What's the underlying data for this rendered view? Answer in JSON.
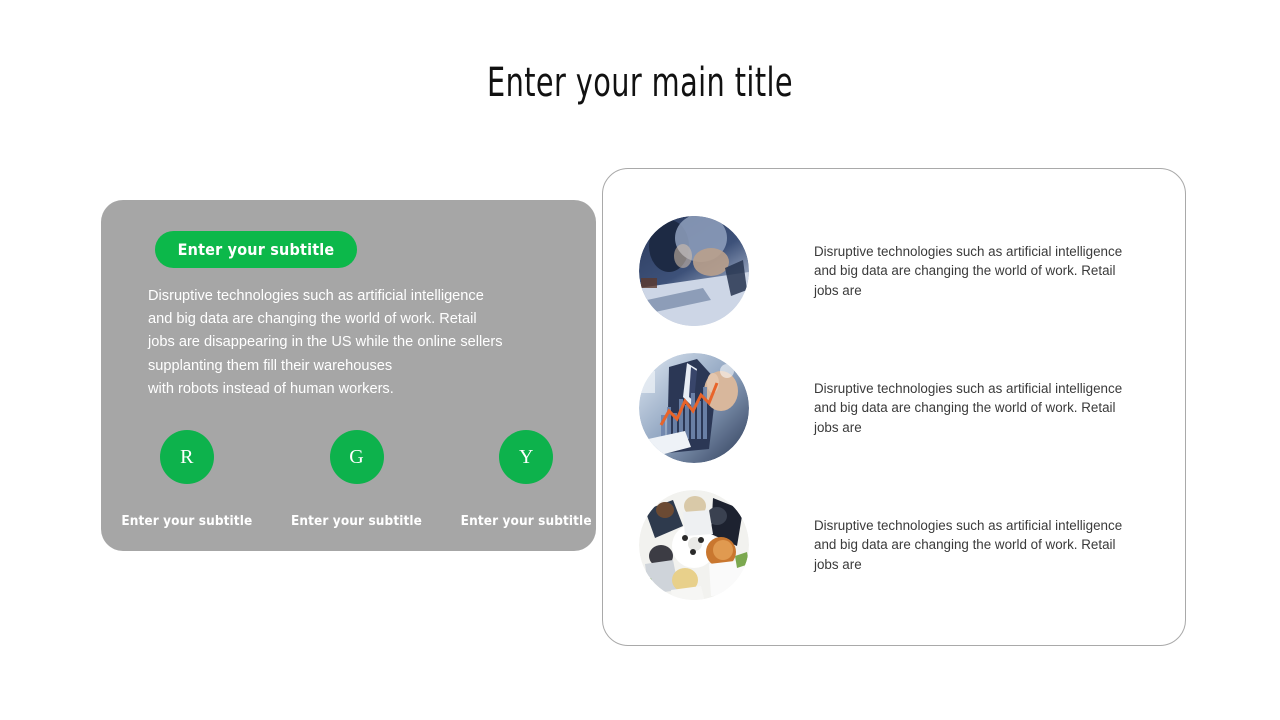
{
  "slide": {
    "title": "Enter your main title",
    "background_color": "#ffffff"
  },
  "theme": {
    "accent_green": "#0cb84a",
    "circle_green": "#0db24c",
    "panel_gray": "#a6a6a6",
    "card_border": "#a9a9a9",
    "body_text_dark": "#3a3a3a",
    "body_text_light": "#ffffff"
  },
  "left_panel": {
    "subtitle_button": "Enter your subtitle",
    "paragraph_lines": [
      "Disruptive technologies such as artificial intelligence",
      "and big data are changing the world of work.  Retail",
      "jobs are disappearing in the US while the online sellers",
      "supplanting them fill their warehouses",
      "with robots instead of human workers."
    ],
    "icons": [
      {
        "letter": "R",
        "caption": "Enter your subtitle"
      },
      {
        "letter": "G",
        "caption": "Enter your subtitle"
      },
      {
        "letter": "Y",
        "caption": "Enter your subtitle"
      }
    ]
  },
  "right_card": {
    "rows": [
      {
        "image_name": "photo-meeting-desk",
        "text_lines": [
          "Disruptive technologies such as artificial intelligence",
          "and big data are changing the world of work.  Retail",
          "jobs are"
        ]
      },
      {
        "image_name": "photo-businessman-chart",
        "text_lines": [
          "Disruptive technologies such as artificial intelligence",
          "and big data are changing the world of work.  Retail",
          "jobs are"
        ]
      },
      {
        "image_name": "photo-team-overhead",
        "text_lines": [
          "Disruptive technologies such as artificial intelligence",
          "and big data are changing the world of work.  Retail",
          "jobs are"
        ]
      }
    ]
  }
}
